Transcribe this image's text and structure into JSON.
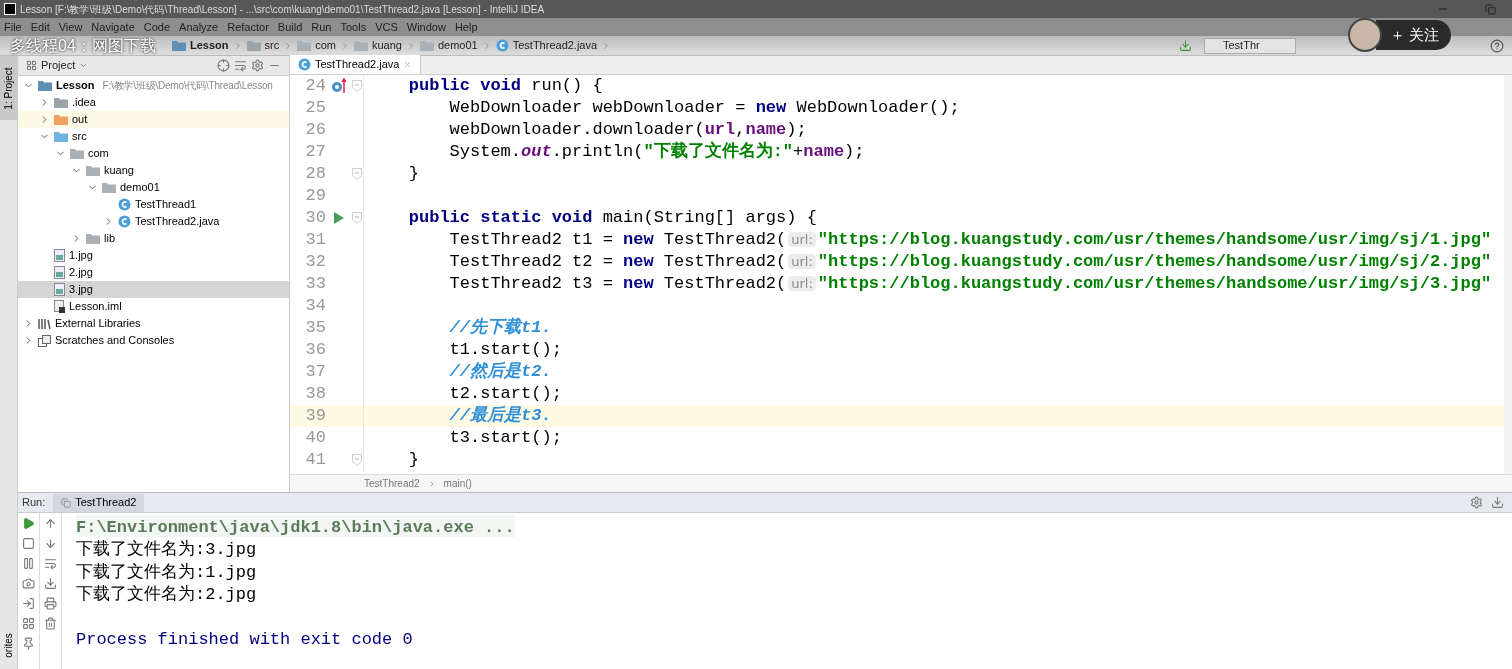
{
  "window": {
    "title": "Lesson [F:\\教学\\班级\\Demo\\代码\\Thread\\Lesson] - ...\\src\\com\\kuang\\demo01\\TestThread2.java [Lesson] - IntelliJ IDEA"
  },
  "menu": [
    "File",
    "Edit",
    "View",
    "Navigate",
    "Code",
    "Analyze",
    "Refactor",
    "Build",
    "Run",
    "Tools",
    "VCS",
    "Window",
    "Help"
  ],
  "video_overlay": {
    "title": "多线程04：网图下载",
    "follow_button": "＋ 关注"
  },
  "navigation_bar": {
    "crumbs": [
      {
        "label": "Lesson",
        "kind": "module"
      },
      {
        "label": "src",
        "kind": "folder"
      },
      {
        "label": "com",
        "kind": "package"
      },
      {
        "label": "kuang",
        "kind": "package"
      },
      {
        "label": "demo01",
        "kind": "package"
      },
      {
        "label": "TestThread2.java",
        "kind": "class"
      }
    ],
    "run_config": "TestThr"
  },
  "side_tabs": {
    "top": "1: Project",
    "bottom": "orites"
  },
  "project_panel": {
    "title": "Project",
    "tree": [
      {
        "label": "Lesson",
        "hint": "F:\\教学\\班级\\Demo\\代码\\Thread\\Lesson",
        "kind": "module",
        "expanded": true,
        "selected": false,
        "children": [
          {
            "label": ".idea",
            "kind": "folder",
            "expanded": false,
            "selected": false
          },
          {
            "label": "out",
            "kind": "excluded",
            "expanded": false,
            "selected": false
          },
          {
            "label": "src",
            "kind": "source",
            "expanded": true,
            "selected": false,
            "children": [
              {
                "label": "com",
                "kind": "package",
                "expanded": true,
                "selected": false,
                "children": [
                  {
                    "label": "kuang",
                    "kind": "package",
                    "expanded": true,
                    "selected": false,
                    "children": [
                      {
                        "label": "demo01",
                        "kind": "package",
                        "expanded": true,
                        "selected": false,
                        "children": [
                          {
                            "label": "TestThread1",
                            "kind": "class",
                            "selected": false
                          },
                          {
                            "label": "TestThread2.java",
                            "kind": "class",
                            "expanded": false,
                            "selected": false
                          }
                        ]
                      }
                    ]
                  },
                  {
                    "label": "lib",
                    "kind": "package",
                    "expanded": false,
                    "selected": false
                  }
                ]
              }
            ]
          },
          {
            "label": "1.jpg",
            "kind": "image",
            "selected": false
          },
          {
            "label": "2.jpg",
            "kind": "image",
            "selected": false
          },
          {
            "label": "3.jpg",
            "kind": "image",
            "selected": true
          },
          {
            "label": "Lesson.iml",
            "kind": "iml",
            "selected": false
          }
        ]
      },
      {
        "label": "External Libraries",
        "kind": "libraries",
        "expanded": false,
        "selected": false
      },
      {
        "label": "Scratches and Consoles",
        "kind": "scratches",
        "expanded": false,
        "selected": false
      }
    ]
  },
  "editor": {
    "tab": "TestThread2.java",
    "lines": [
      {
        "number": "24",
        "kind": "override",
        "fold": true,
        "current": false,
        "tokens": [
          {
            "kind": "kw",
            "text": "    public void"
          },
          {
            "kind": "plain",
            "text": " run() {"
          }
        ]
      },
      {
        "number": "25",
        "kind": "code",
        "fold": false,
        "current": false,
        "tokens": [
          {
            "kind": "plain",
            "text": "        WebDownloader webDownloader = "
          },
          {
            "kind": "kw",
            "text": "new"
          },
          {
            "kind": "plain",
            "text": " WebDownloader();"
          }
        ]
      },
      {
        "number": "26",
        "kind": "code",
        "fold": false,
        "current": false,
        "tokens": [
          {
            "kind": "plain",
            "text": "        webDownloader.downloader("
          },
          {
            "kind": "var",
            "text": "url"
          },
          {
            "kind": "plain",
            "text": ","
          },
          {
            "kind": "var",
            "text": "name"
          },
          {
            "kind": "plain",
            "text": ");"
          }
        ]
      },
      {
        "number": "27",
        "kind": "code",
        "fold": false,
        "current": false,
        "tokens": [
          {
            "kind": "plain",
            "text": "        System."
          },
          {
            "kind": "field",
            "text": "out"
          },
          {
            "kind": "plain",
            "text": ".println("
          },
          {
            "kind": "str",
            "text": "\"下载了文件名为:\""
          },
          {
            "kind": "plain",
            "text": "+"
          },
          {
            "kind": "var",
            "text": "name"
          },
          {
            "kind": "plain",
            "text": ");"
          }
        ]
      },
      {
        "number": "28",
        "kind": "code",
        "fold": true,
        "current": false,
        "tokens": [
          {
            "kind": "plain",
            "text": "    }"
          }
        ]
      },
      {
        "number": "29",
        "kind": "code",
        "fold": false,
        "current": false
      },
      {
        "number": "30",
        "kind": "run",
        "fold": true,
        "current": false,
        "tokens": [
          {
            "kind": "kw",
            "text": "    public static void"
          },
          {
            "kind": "plain",
            "text": " main(String[] args) {"
          }
        ]
      },
      {
        "number": "31",
        "kind": "code",
        "fold": false,
        "current": false,
        "tokens": [
          {
            "kind": "plain",
            "text": "        TestThread2 t1 = "
          },
          {
            "kind": "kw",
            "text": "new"
          },
          {
            "kind": "plain",
            "text": " TestThread2("
          },
          {
            "kind": "hint",
            "text": "url:"
          },
          {
            "kind": "str",
            "text": "\"https://blog.kuangstudy.com/usr/themes/handsome/usr/img/sj/1.jpg\""
          }
        ]
      },
      {
        "number": "32",
        "kind": "code",
        "fold": false,
        "current": false,
        "tokens": [
          {
            "kind": "plain",
            "text": "        TestThread2 t2 = "
          },
          {
            "kind": "kw",
            "text": "new"
          },
          {
            "kind": "plain",
            "text": " TestThread2("
          },
          {
            "kind": "hint",
            "text": "url:"
          },
          {
            "kind": "str",
            "text": "\"https://blog.kuangstudy.com/usr/themes/handsome/usr/img/sj/2.jpg\""
          }
        ]
      },
      {
        "number": "33",
        "kind": "code",
        "fold": false,
        "current": false,
        "tokens": [
          {
            "kind": "plain",
            "text": "        TestThread2 t3 = "
          },
          {
            "kind": "kw",
            "text": "new"
          },
          {
            "kind": "plain",
            "text": " TestThread2("
          },
          {
            "kind": "hint",
            "text": "url:"
          },
          {
            "kind": "str",
            "text": "\"https://blog.kuangstudy.com/usr/themes/handsome/usr/img/sj/3.jpg\""
          }
        ]
      },
      {
        "number": "34",
        "kind": "code",
        "fold": false,
        "current": false
      },
      {
        "number": "35",
        "kind": "code",
        "fold": false,
        "current": false,
        "tokens": [
          {
            "kind": "comment",
            "text": "        //先下载t1."
          }
        ]
      },
      {
        "number": "36",
        "kind": "code",
        "fold": false,
        "current": false,
        "tokens": [
          {
            "kind": "plain",
            "text": "        t1.start();"
          }
        ]
      },
      {
        "number": "37",
        "kind": "code",
        "fold": false,
        "current": false,
        "tokens": [
          {
            "kind": "comment",
            "text": "        //然后是t2."
          }
        ]
      },
      {
        "number": "38",
        "kind": "code",
        "fold": false,
        "current": false,
        "tokens": [
          {
            "kind": "plain",
            "text": "        t2.start();"
          }
        ]
      },
      {
        "number": "39",
        "kind": "code",
        "fold": false,
        "current": true,
        "tokens": [
          {
            "kind": "comment",
            "text": "        //最后是t3."
          }
        ]
      },
      {
        "number": "40",
        "kind": "code",
        "fold": false,
        "current": false,
        "tokens": [
          {
            "kind": "plain",
            "text": "        t3.start();"
          }
        ]
      },
      {
        "number": "41",
        "kind": "code",
        "fold": true,
        "current": false,
        "tokens": [
          {
            "kind": "plain",
            "text": "    }"
          }
        ]
      }
    ],
    "breadcrumbs": [
      "TestThread2",
      "main()"
    ]
  },
  "run_panel": {
    "label": "Run:",
    "tab": "TestThread2",
    "console": [
      {
        "kind": "command",
        "text": "F:\\Environment\\java\\jdk1.8\\bin\\java.exe ..."
      },
      {
        "kind": "output",
        "text": "下载了文件名为:3.jpg"
      },
      {
        "kind": "output",
        "text": "下载了文件名为:1.jpg"
      },
      {
        "kind": "output",
        "text": "下载了文件名为:2.jpg"
      },
      {
        "kind": "blank"
      },
      {
        "kind": "exit",
        "text": "Process finished with exit code 0"
      }
    ]
  }
}
